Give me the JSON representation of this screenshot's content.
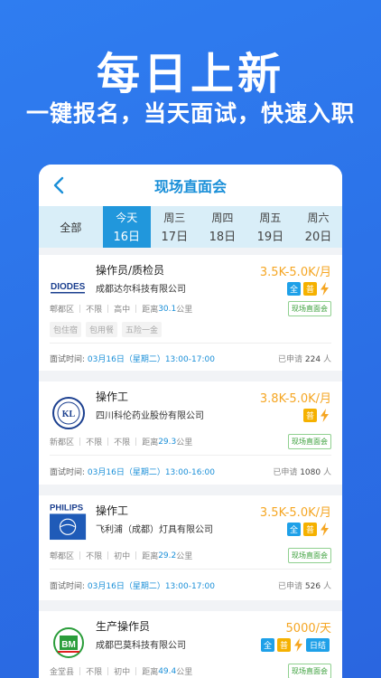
{
  "hero": {
    "title": "每日上新",
    "subtitle": "一键报名，当天面试，快速入职"
  },
  "nav": {
    "title": "现场直面会"
  },
  "tabs": {
    "all": "全部",
    "dates": [
      {
        "day": "今天",
        "date": "16日",
        "active": true
      },
      {
        "day": "周三",
        "date": "17日"
      },
      {
        "day": "周四",
        "date": "18日"
      },
      {
        "day": "周五",
        "date": "19日"
      },
      {
        "day": "周六",
        "date": "20日"
      }
    ]
  },
  "jobs": [
    {
      "logo": "DIODES",
      "title": "操作员/质检员",
      "company": "成都达尔科技有限公司",
      "salary": "3.5K-5.0K/月",
      "badges": [
        "全",
        "普"
      ],
      "district": "郫都区",
      "exp": "不限",
      "edu": "高中",
      "distance_prefix": "距离",
      "distance": "30.1",
      "distance_unit": "公里",
      "tag": "现场直面会",
      "benefits": [
        "包住宿",
        "包用餐",
        "五险一金"
      ],
      "time_label": "面试时间:",
      "time": "03月16日（星期二）13:00-17:00",
      "applied_prefix": "已申请",
      "applied": "224",
      "applied_unit": "人"
    },
    {
      "logo": "KL",
      "title": "操作工",
      "company": "四川科伦药业股份有限公司",
      "salary": "3.8K-5.0K/月",
      "badges": [
        "普"
      ],
      "district": "新都区",
      "exp": "不限",
      "edu": "不限",
      "distance_prefix": "距离",
      "distance": "29.3",
      "distance_unit": "公里",
      "tag": "现场直面会",
      "time_label": "面试时间:",
      "time": "03月16日（星期二）13:00-16:00",
      "applied_prefix": "已申请",
      "applied": "1080",
      "applied_unit": "人"
    },
    {
      "logo": "PHILIPS",
      "title": "操作工",
      "company": "飞利浦（成都）灯具有限公司",
      "salary": "3.5K-5.0K/月",
      "badges": [
        "全",
        "普"
      ],
      "district": "郫都区",
      "exp": "不限",
      "edu": "初中",
      "distance_prefix": "距离",
      "distance": "29.2",
      "distance_unit": "公里",
      "tag": "现场直面会",
      "time_label": "面试时间:",
      "time": "03月16日（星期二）13:00-17:00",
      "applied_prefix": "已申请",
      "applied": "526",
      "applied_unit": "人"
    },
    {
      "logo": "BM",
      "title": "生产操作员",
      "company": "成都巴莫科技有限公司",
      "salary": "5000/天",
      "badges": [
        "全",
        "普",
        "日结"
      ],
      "district": "金堂县",
      "exp": "不限",
      "edu": "初中",
      "distance_prefix": "距离",
      "distance": "49.4",
      "distance_unit": "公里",
      "tag": "现场直面会"
    }
  ]
}
